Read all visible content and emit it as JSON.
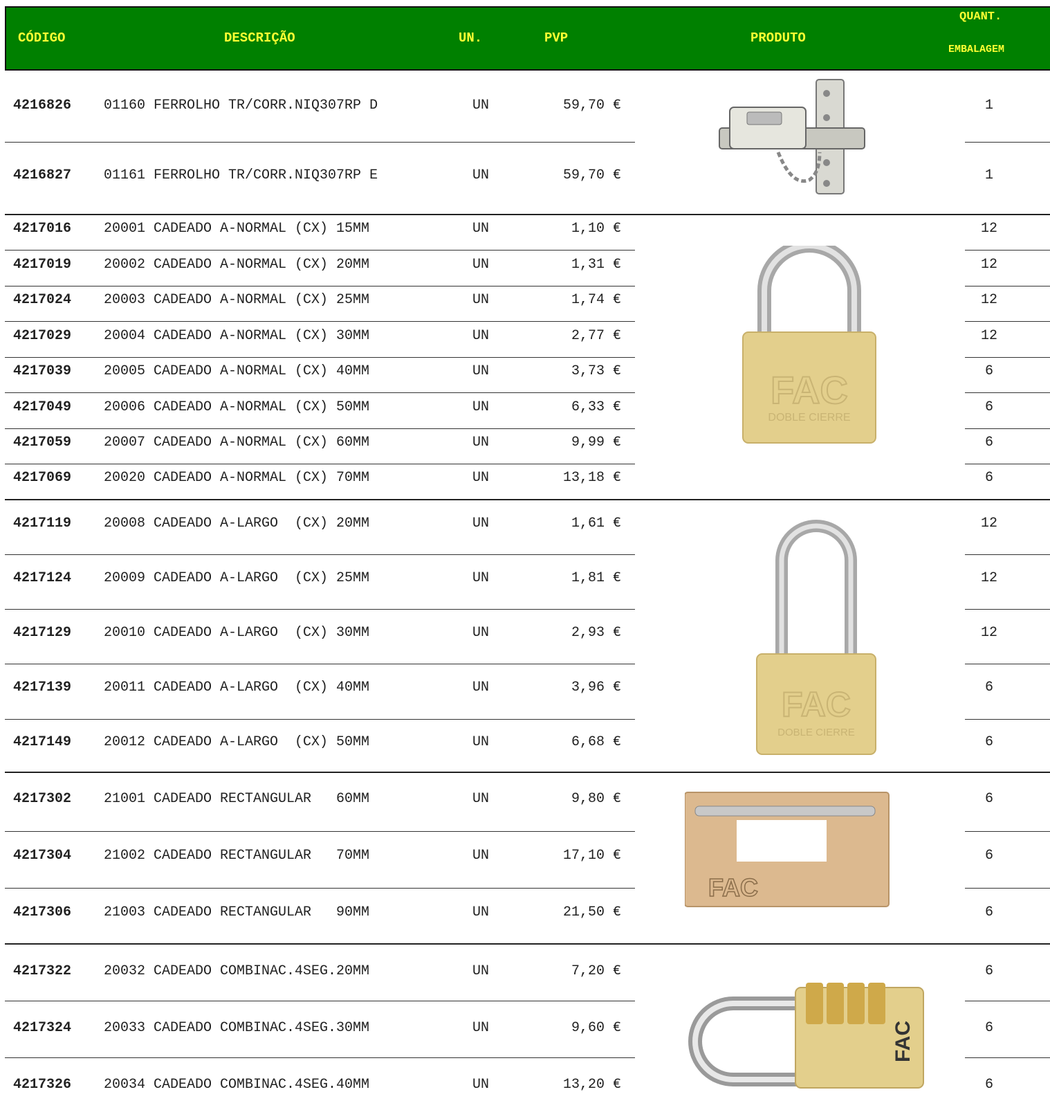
{
  "header": {
    "codigo": "CÓDIGO",
    "descricao": "DESCRIÇÃO",
    "un": "UN.",
    "pvp": "PVP",
    "produto": "PRODUTO",
    "quant": "QUANT.",
    "embalagem": "EMBALAGEM"
  },
  "colors": {
    "header_bg": "#008000",
    "header_text": "#ffff33"
  },
  "rows": [
    {
      "code": "4216826",
      "desc": "01160 FERROLHO TR/CORR.NIQ307RP D",
      "un": "UN",
      "price": "59,70 €",
      "qty": "1"
    },
    {
      "code": "4216827",
      "desc": "01161 FERROLHO TR/CORR.NIQ307RP E",
      "un": "UN",
      "price": "59,70 €",
      "qty": "1"
    },
    {
      "code": "4217016",
      "desc": "20001 CADEADO A-NORMAL (CX) 15MM",
      "un": "UN",
      "price": "1,10 €",
      "qty": "12"
    },
    {
      "code": "4217019",
      "desc": "20002 CADEADO A-NORMAL (CX) 20MM",
      "un": "UN",
      "price": "1,31 €",
      "qty": "12"
    },
    {
      "code": "4217024",
      "desc": "20003 CADEADO A-NORMAL (CX) 25MM",
      "un": "UN",
      "price": "1,74 €",
      "qty": "12"
    },
    {
      "code": "4217029",
      "desc": "20004 CADEADO A-NORMAL (CX) 30MM",
      "un": "UN",
      "price": "2,77 €",
      "qty": "12"
    },
    {
      "code": "4217039",
      "desc": "20005 CADEADO A-NORMAL (CX) 40MM",
      "un": "UN",
      "price": "3,73 €",
      "qty": "6"
    },
    {
      "code": "4217049",
      "desc": "20006 CADEADO A-NORMAL (CX) 50MM",
      "un": "UN",
      "price": "6,33 €",
      "qty": "6"
    },
    {
      "code": "4217059",
      "desc": "20007 CADEADO A-NORMAL (CX) 60MM",
      "un": "UN",
      "price": "9,99 €",
      "qty": "6"
    },
    {
      "code": "4217069",
      "desc": "20020 CADEADO A-NORMAL (CX) 70MM",
      "un": "UN",
      "price": "13,18 €",
      "qty": "6"
    },
    {
      "code": "4217119",
      "desc": "20008 CADEADO A-LARGO  (CX) 20MM",
      "un": "UN",
      "price": "1,61 €",
      "qty": "12"
    },
    {
      "code": "4217124",
      "desc": "20009 CADEADO A-LARGO  (CX) 25MM",
      "un": "UN",
      "price": "1,81 €",
      "qty": "12"
    },
    {
      "code": "4217129",
      "desc": "20010 CADEADO A-LARGO  (CX) 30MM",
      "un": "UN",
      "price": "2,93 €",
      "qty": "12"
    },
    {
      "code": "4217139",
      "desc": "20011 CADEADO A-LARGO  (CX) 40MM",
      "un": "UN",
      "price": "3,96 €",
      "qty": "6"
    },
    {
      "code": "4217149",
      "desc": "20012 CADEADO A-LARGO  (CX) 50MM",
      "un": "UN",
      "price": "6,68 €",
      "qty": "6"
    },
    {
      "code": "4217302",
      "desc": "21001 CADEADO RECTANGULAR   60MM",
      "un": "UN",
      "price": "9,80 €",
      "qty": "6"
    },
    {
      "code": "4217304",
      "desc": "21002 CADEADO RECTANGULAR   70MM",
      "un": "UN",
      "price": "17,10 €",
      "qty": "6"
    },
    {
      "code": "4217306",
      "desc": "21003 CADEADO RECTANGULAR   90MM",
      "un": "UN",
      "price": "21,50 €",
      "qty": "6"
    },
    {
      "code": "4217322",
      "desc": "20032 CADEADO COMBINAC.4SEG.20MM",
      "un": "UN",
      "price": "7,20 €",
      "qty": "6"
    },
    {
      "code": "4217324",
      "desc": "20033 CADEADO COMBINAC.4SEG.30MM",
      "un": "UN",
      "price": "9,60 €",
      "qty": "6"
    },
    {
      "code": "4217326",
      "desc": "20034 CADEADO COMBINAC.4SEG.40MM",
      "un": "UN",
      "price": "13,20 €",
      "qty": "6"
    }
  ],
  "products": [
    {
      "icon": "door-bolt-chain-icon"
    },
    {
      "icon": "padlock-normal-icon",
      "label1": "FAC",
      "label2": "DOBLE CIERRE"
    },
    {
      "icon": "padlock-long-shackle-icon",
      "label1": "FAC",
      "label2": "DOBLE CIERRE"
    },
    {
      "icon": "padlock-rectangular-icon",
      "label1": "FAC"
    },
    {
      "icon": "padlock-combination-icon",
      "label1": "FAC"
    }
  ]
}
